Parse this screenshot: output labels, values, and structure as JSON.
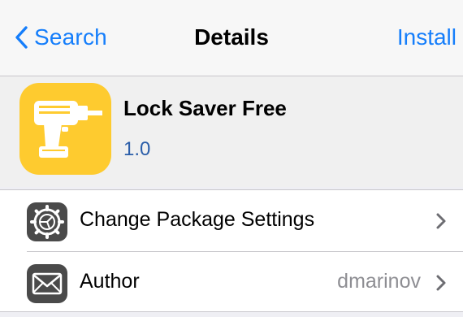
{
  "navbar": {
    "back_label": "Search",
    "title": "Details",
    "action_label": "Install"
  },
  "package": {
    "name": "Lock Saver Free",
    "version": "1.0",
    "icon": "drill-icon"
  },
  "rows": [
    {
      "icon": "gear-icon",
      "label": "Change Package Settings",
      "value": ""
    },
    {
      "icon": "envelope-icon",
      "label": "Author",
      "value": "dmarinov"
    }
  ],
  "colors": {
    "accent": "#157efb",
    "version_text": "#2b5ea9",
    "app_icon_bg": "#fecb2f",
    "row_icon_bg": "#4a4a4a",
    "secondary_text": "#8e8e93"
  }
}
